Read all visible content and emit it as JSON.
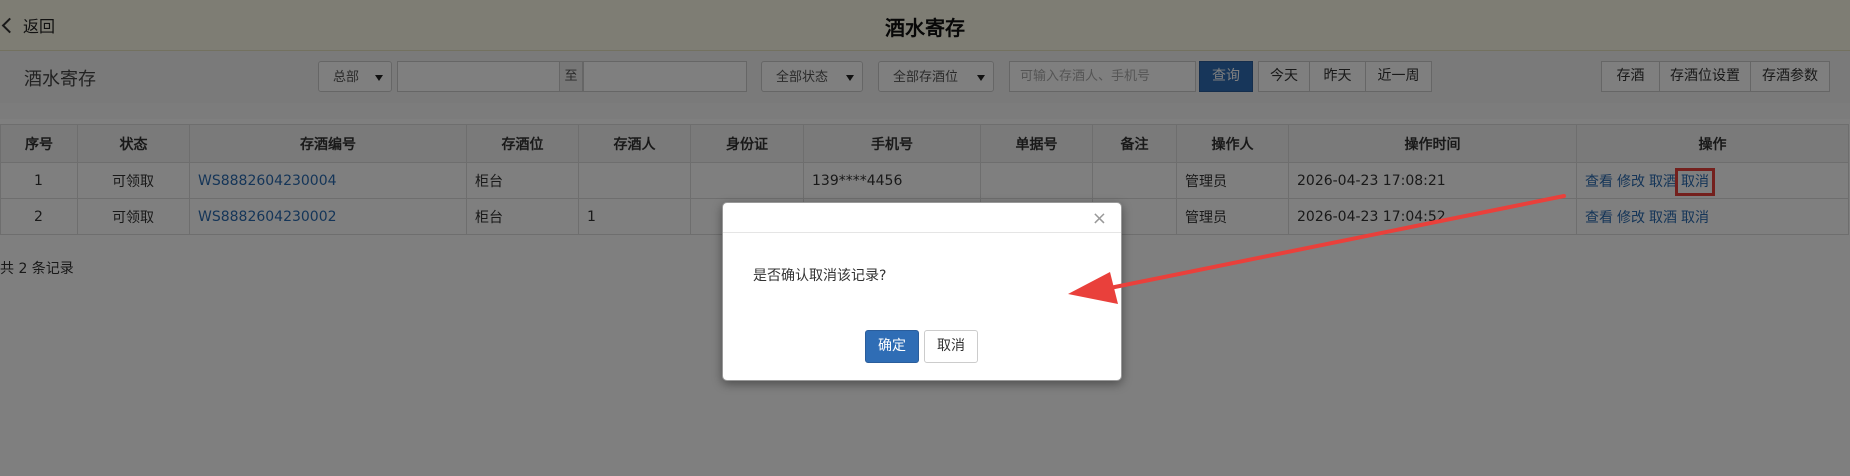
{
  "topbar": {
    "back_label": "返回",
    "title": "酒水寄存"
  },
  "toolbar": {
    "title": "酒水寄存",
    "store_select": "总部",
    "date_to": "至",
    "status_select": "全部状态",
    "location_select": "全部存酒位",
    "search_placeholder": "可输入存酒人、手机号",
    "query_label": "查询",
    "today_label": "今天",
    "yesterday_label": "昨天",
    "week_label": "近一周",
    "store_wine_label": "存酒",
    "location_settings_label": "存酒位设置",
    "params_label": "存酒参数"
  },
  "table": {
    "headers": [
      "序号",
      "状态",
      "存酒编号",
      "存酒位",
      "存酒人",
      "身份证",
      "手机号",
      "单据号",
      "备注",
      "操作人",
      "操作时间",
      "操作"
    ],
    "rows": [
      {
        "no": "1",
        "status": "可领取",
        "code": "WS8882604230004",
        "location": "柜台",
        "person": "",
        "id_card": "",
        "phone": "139****4456",
        "receipt": "",
        "note": "",
        "operator": "管理员",
        "time": "2026-04-23 17:08:21",
        "ops": [
          "查看",
          "修改",
          "取酒",
          "取消"
        ]
      },
      {
        "no": "2",
        "status": "可领取",
        "code": "WS8882604230002",
        "location": "柜台",
        "person": "1",
        "id_card": "",
        "phone": "",
        "receipt": "",
        "note": "",
        "operator": "管理员",
        "time": "2026-04-23 17:04:52",
        "ops": [
          "查看",
          "修改",
          "取酒",
          "取消"
        ]
      }
    ],
    "total": "共 2 条记录"
  },
  "modal": {
    "close_glyph": "×",
    "message": "是否确认取消该记录?",
    "confirm_label": "确定",
    "cancel_label": "取消"
  },
  "colors": {
    "accent": "#2f6db5",
    "annotation": "#e9403b",
    "topbar_bg": "#fdfbe8"
  }
}
